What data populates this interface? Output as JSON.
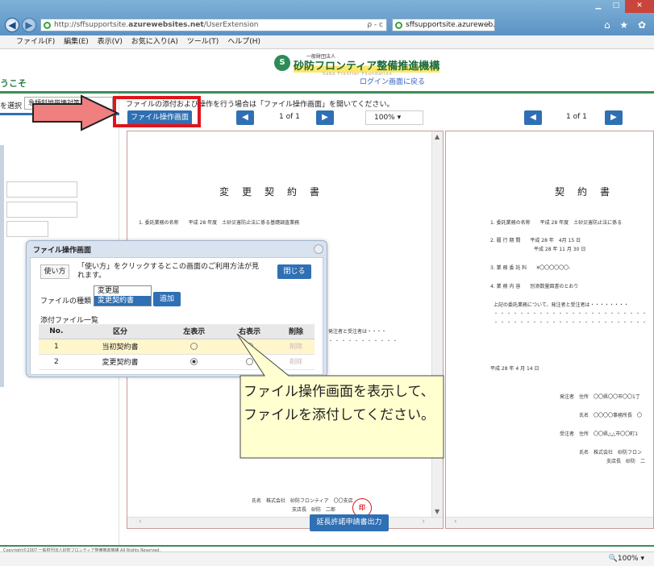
{
  "browser": {
    "address_prefix": "http://sffsupportsite.",
    "address_host": "azurewebsites.net",
    "address_path": "/UserExtension",
    "address_controls": "ρ - c",
    "tab_title": "sffsupportsite.azureweb...",
    "tab_close": "×",
    "toolbar_icons": "⌂ ★ ✿",
    "menu": [
      "ファイル(F)",
      "編集(E)",
      "表示(V)",
      "お気に入り(A)",
      "ツール(T)",
      "ヘルプ(H)"
    ],
    "zoom_status": "🔍100%  ▾"
  },
  "header": {
    "logo_mark": "S",
    "logo_small": "一般財団法人",
    "logo_main": "砂防フロンティア整備推進機構",
    "logo_sub": "Sabo Frontier Foundation",
    "back_link": "ログイン画面に戻る",
    "welcome": "うこそ"
  },
  "left": {
    "select_label": "を選択",
    "select_value": "急傾斜地崩壊対策 ▾"
  },
  "main": {
    "instruction": "ファイルの添付および操作を行う場合は「ファイル操作画面」を開いてください。",
    "file_op_button": "ファイル操作画面",
    "prev": "◀",
    "next": "▶",
    "page_left": "1 of 1",
    "page_right": "1 of 1",
    "zoom": "100%  ▾",
    "bottom_button": "延長許諾申請書出力",
    "copyright": "Copyright©2007 一般財団法人砂防フロンティア整備推進機構 All Rights Reserved."
  },
  "doc_left": {
    "title": "変更契約書",
    "line1": "1. 委託業務の名称　　平成 28 年度　土砂災害防止法に係る基礎調査業務",
    "tail": "発注者と受注者は・・・・",
    "sign": "氏名　株式会社　砂防フロンティア　〇〇支店",
    "sign2": "支店長　砂防　二郎",
    "seal": "印"
  },
  "doc_right": {
    "title": "契約書",
    "items": [
      "1. 委託業務の名称　　平成 28 年度　土砂災害防止法に係る",
      "2. 履 行 期 間　　平成 28 年　4月 15 日",
      "　　　　　　　　　平成 28 年 11 月 30 日",
      "3. 業 務 委 託 料　　¥〇〇〇〇〇〇-",
      "4. 業 務 内 容　　別添数量図書のとおり",
      "上記の委託業務について、発注者と受注者は・・・・・・・・"
    ],
    "date": "平成 28 年 4 月 14 日",
    "orderer": "発注者　住所　〇〇県〇〇市〇〇1丁",
    "orderer_name": "氏名　〇〇〇〇事務所長　〇",
    "contractor": "受注者　住所　〇〇県△△市〇〇町1",
    "contractor_name": "氏名　株式会社　砂防フロン",
    "contractor_name2": "支店長　砂防　二"
  },
  "dialog": {
    "title": "ファイル操作画面",
    "help_button": "使い方",
    "help_text": "「使い方」をクリックするとこの画面のご利用方法が見れます。",
    "close_button": "閉じる",
    "type_label": "ファイルの種類",
    "type_options": [
      "変更届",
      "変更契約書"
    ],
    "add_button": "追加",
    "list_label": "添付ファイル一覧",
    "columns": [
      "No.",
      "区分",
      "左表示",
      "右表示",
      "削除"
    ],
    "rows": [
      {
        "no": "1",
        "kind": "当初契約書",
        "del": "削除"
      },
      {
        "no": "2",
        "kind": "変更契約書",
        "del": "削除"
      }
    ]
  },
  "callout": {
    "text": "ファイル操作画面を表示して、ファイルを添付してください。"
  },
  "colors": {
    "accent_blue": "#2f6fb3",
    "highlight_red": "#e0141c",
    "brand_green": "#3d8c54"
  }
}
